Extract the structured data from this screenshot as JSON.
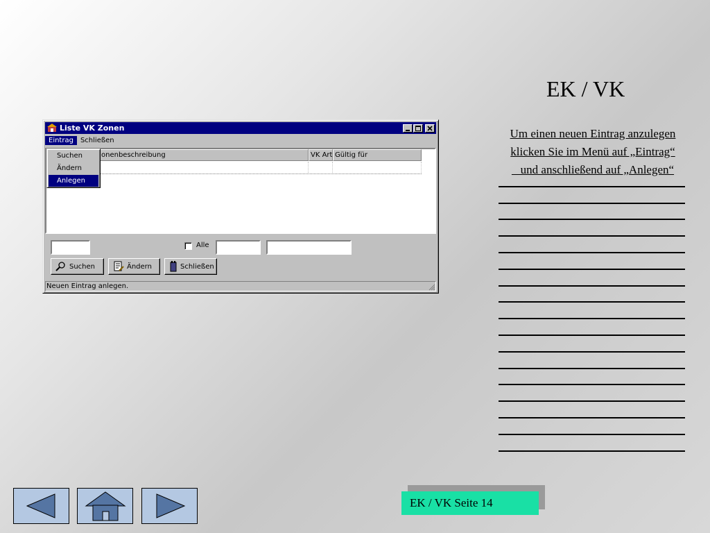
{
  "window": {
    "title": "Liste VK Zonen",
    "menu": {
      "eintrag": "Eintrag",
      "schliessen": "Schließen"
    },
    "dropdown": {
      "suchen": "Suchen",
      "aendern": "Ändern",
      "anlegen": "Anlegen"
    },
    "columns": [
      "onenbeschreibung",
      "VK Art",
      "Gültig für"
    ],
    "filter": {
      "alle_label": "Alle",
      "alle_checked": false
    },
    "buttons": {
      "suchen": "Suchen",
      "aendern": "Ändern",
      "schliessen": "Schließen"
    },
    "status": "Neuen Eintrag anlegen."
  },
  "slide": {
    "title": "EK / VK",
    "instructions": [
      "Um einen neuen Eintrag anzulegen",
      "klicken Sie im Menü auf „Eintrag“",
      "   und anschließend auf „Anlegen“"
    ],
    "page_label": "EK / VK Seite 14"
  },
  "nav": {
    "prev_icon": "left-arrow-icon",
    "home_icon": "home-icon",
    "next_icon": "right-arrow-icon"
  },
  "colors": {
    "titlebar": "#000080",
    "nav_button": "#b4c8e2",
    "page_box": "#19e0a5"
  }
}
